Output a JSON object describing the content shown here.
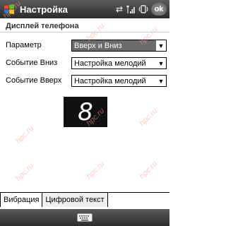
{
  "window": {
    "title": "Настройка",
    "ok_label": "ok"
  },
  "tray_icons": [
    "connectivity-icon",
    "signal-icon",
    "vibrate-icon"
  ],
  "section": {
    "header": "Дисплей телефона"
  },
  "form": {
    "rows": [
      {
        "label": "Параметр",
        "value": "Вверх и Вниз"
      },
      {
        "label": "Событие Вниз",
        "value": "Настройка мелодий"
      },
      {
        "label": "Событие Вверх",
        "value": "Настройка мелодий"
      }
    ]
  },
  "display": {
    "digit": "8"
  },
  "watermark_text": "hpc.ru",
  "tabs": [
    {
      "label": "Вибрация"
    },
    {
      "label": "Цифровой текст"
    }
  ],
  "colors": {
    "titlebar": "#3a3a3a",
    "selected_field": "#6b6b6b",
    "watermark": "#ff9c9c"
  }
}
